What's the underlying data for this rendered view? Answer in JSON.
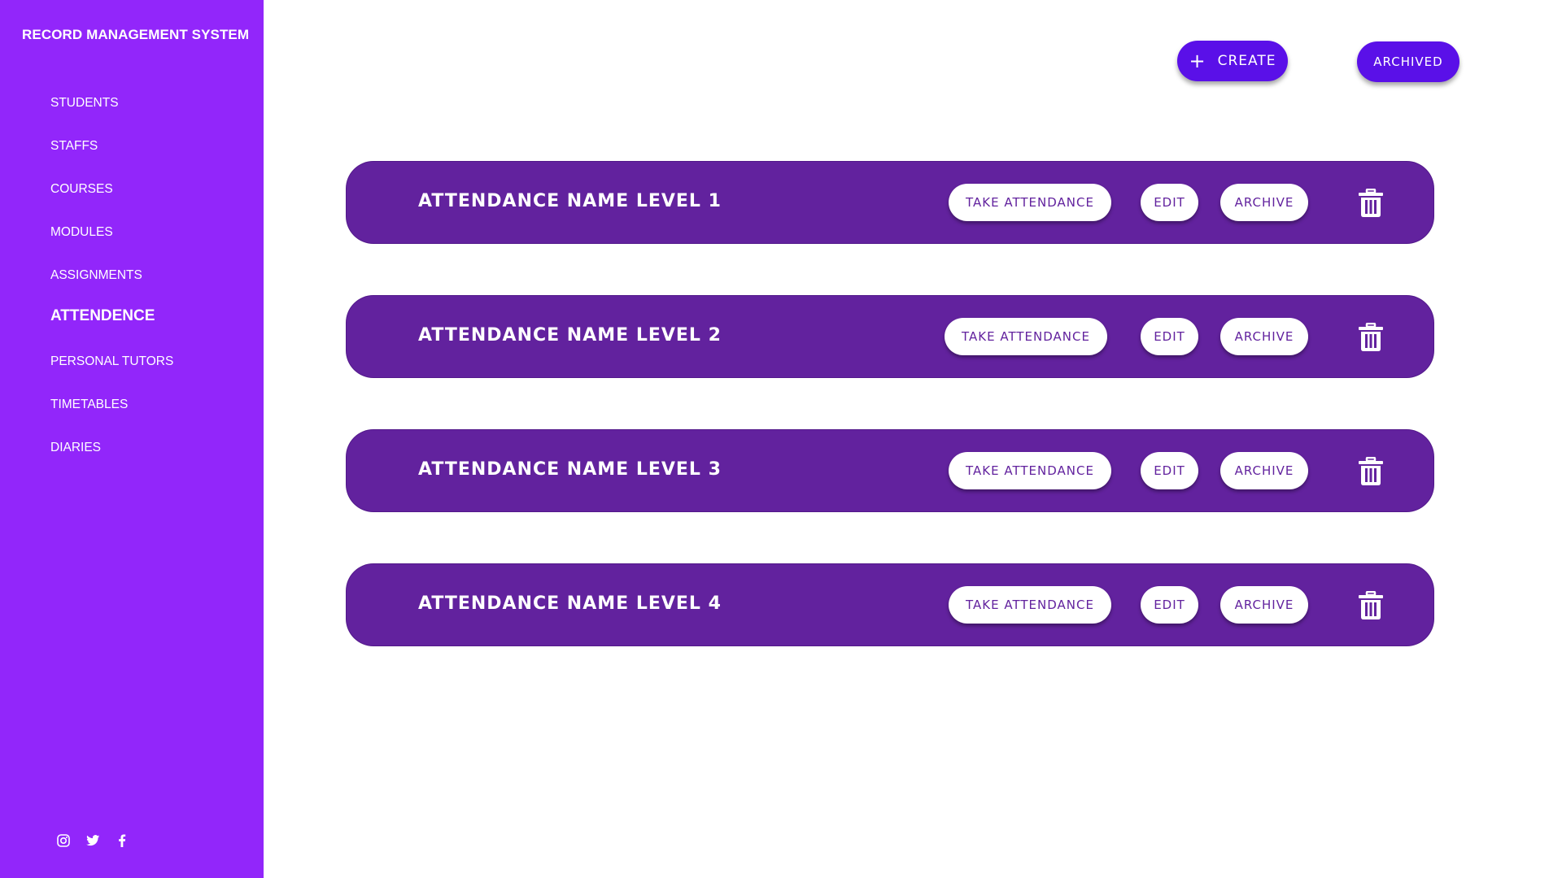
{
  "sidebar": {
    "brand": "RECORD MANAGEMENT SYSTEM",
    "nav_items": [
      {
        "label": "STUDENTS"
      },
      {
        "label": "STAFFS"
      },
      {
        "label": "COURSES"
      },
      {
        "label": "MODULES"
      },
      {
        "label": "ASSIGNMENTS"
      },
      {
        "label": "ATTENDENCE",
        "active": true
      },
      {
        "label": "PERSONAL TUTORS"
      },
      {
        "label": "TIMETABLES"
      },
      {
        "label": "DIARIES"
      }
    ],
    "social": [
      {
        "icon": "instagram-icon"
      },
      {
        "icon": "twitter-icon"
      },
      {
        "icon": "facebook-icon"
      }
    ]
  },
  "toolbar": {
    "create_icon": "+",
    "create_label": "CREATE",
    "archived_label": "ARCHIVED"
  },
  "attendance_list": [
    {
      "title": "ATTENDANCE NAME LEVEL 1",
      "take_label": "TAKE ATTENDANCE",
      "edit_label": "EDIT",
      "archive_label": "ARCHIVE",
      "delete_icon": "trash-icon"
    },
    {
      "title": "ATTENDANCE NAME LEVEL 2",
      "take_label": "TAKE ATTENDANCE",
      "edit_label": "EDIT",
      "archive_label": "ARCHIVE",
      "delete_icon": "trash-icon"
    },
    {
      "title": "ATTENDANCE NAME LEVEL 3",
      "take_label": "TAKE ATTENDANCE",
      "edit_label": "EDIT",
      "archive_label": "ARCHIVE",
      "delete_icon": "trash-icon"
    },
    {
      "title": "ATTENDANCE NAME LEVEL 4",
      "take_label": "TAKE ATTENDANCE",
      "edit_label": "EDIT",
      "archive_label": "ARCHIVE",
      "delete_icon": "trash-icon"
    }
  ],
  "colors": {
    "sidebar_bg": "#9226fa",
    "card_bg": "#62229e",
    "button_bg": "#5a10e8",
    "pill_bg": "#ffffff",
    "pill_text": "#62229e"
  }
}
